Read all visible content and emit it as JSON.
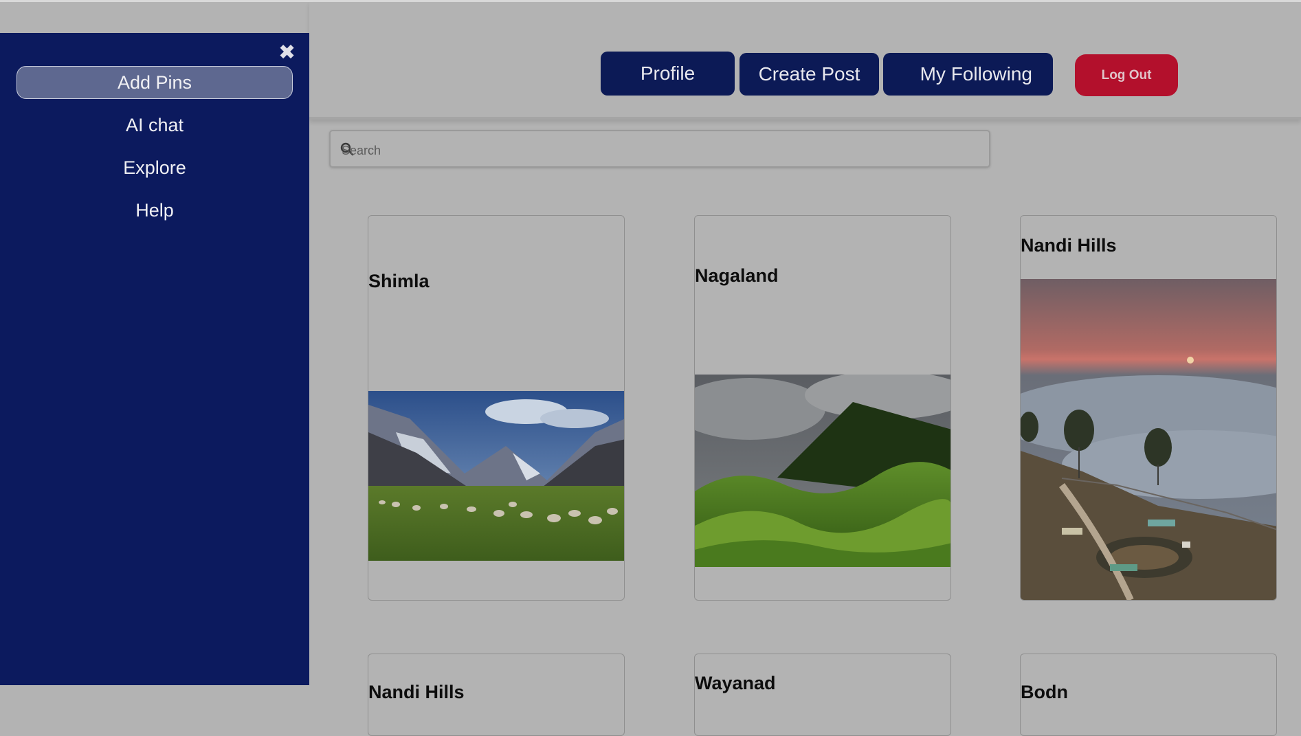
{
  "header": {
    "nav": [
      {
        "label": "Profile"
      },
      {
        "label": "Create Post"
      },
      {
        "label": "My Following"
      }
    ],
    "logout_label": "Log Out"
  },
  "search": {
    "placeholder": "Search"
  },
  "sidebar": {
    "close_glyph": "✖",
    "items": [
      {
        "label": "Add Pins",
        "active": true
      },
      {
        "label": "AI chat"
      },
      {
        "label": "Explore"
      },
      {
        "label": "Help"
      }
    ]
  },
  "cards": [
    {
      "title": "Shimla",
      "image": "mountain-valley-sheep"
    },
    {
      "title": "Nagaland",
      "image": "green-hills-clouds"
    },
    {
      "title": "Nandi Hills",
      "image": "sunrise-above-clouds-garden"
    },
    {
      "title": "Nandi Hills"
    },
    {
      "title": "Wayanad"
    },
    {
      "title": "Bodn"
    }
  ],
  "colors": {
    "sidebar": "#0c1a5e",
    "nav_button": "#0c1a56",
    "logout": "#b3102c",
    "overlay_bg": "#b3b3b3"
  }
}
